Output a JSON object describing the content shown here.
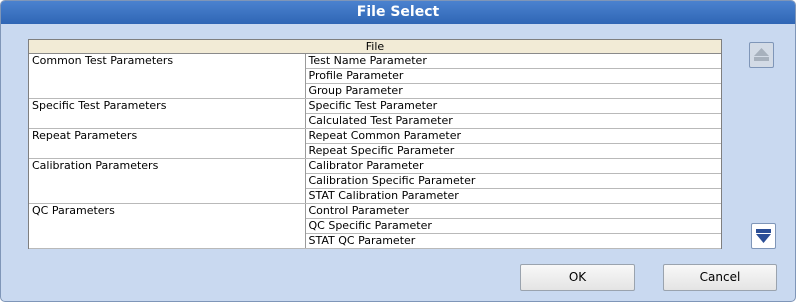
{
  "title": "File Select",
  "table": {
    "header": "File",
    "groups": [
      {
        "category": "Common Test Parameters",
        "items": [
          "Test Name Parameter",
          "Profile Parameter",
          "Group Parameter"
        ]
      },
      {
        "category": "Specific Test Parameters",
        "items": [
          "Specific Test Parameter",
          "Calculated Test Parameter"
        ]
      },
      {
        "category": "Repeat Parameters",
        "items": [
          "Repeat Common Parameter",
          "Repeat Specific Parameter"
        ]
      },
      {
        "category": "Calibration Parameters",
        "items": [
          "Calibrator Parameter",
          "Calibration Specific Parameter",
          "STAT Calibration Parameter"
        ]
      },
      {
        "category": "QC Parameters",
        "items": [
          "Control Parameter",
          "QC Specific Parameter",
          "STAT QC Parameter"
        ]
      }
    ]
  },
  "buttons": {
    "ok": "OK",
    "cancel": "Cancel"
  },
  "icons": {
    "scroll_up": "arrow-up-icon",
    "scroll_down": "arrow-down-icon"
  },
  "colors": {
    "title_bar": "#2f66b5",
    "dialog_bg": "#c9d9f0",
    "header_bg": "#f2ebd6"
  }
}
